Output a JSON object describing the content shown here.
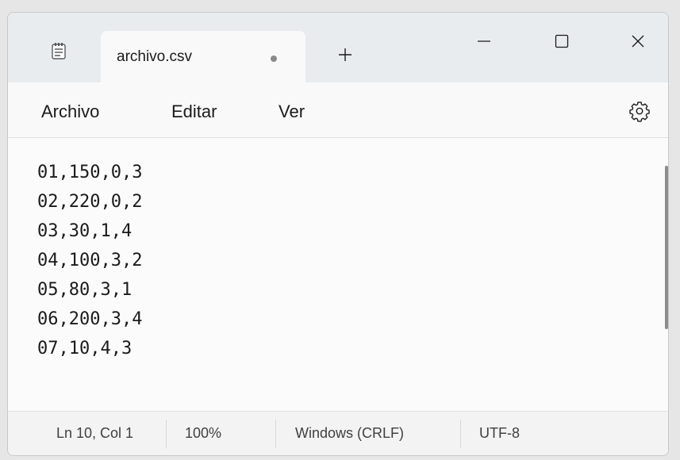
{
  "window": {
    "tab_title": "archivo.csv",
    "tab_state": "unsaved",
    "app_icon": "notepad-icon",
    "new_tab_icon": "plus-icon",
    "controls": [
      "minimize-icon",
      "maximize-icon",
      "close-icon"
    ]
  },
  "menu": {
    "items": [
      "Archivo",
      "Editar",
      "Ver"
    ],
    "settings_icon": "gear-icon"
  },
  "editor": {
    "lines": [
      "01,150,0,3",
      "02,220,0,2",
      "03,30,1,4",
      "04,100,3,2",
      "05,80,3,1",
      "06,200,3,4",
      "07,10,4,3"
    ]
  },
  "status": {
    "position": "Ln 10, Col 1",
    "zoom": "100%",
    "line_ending": "Windows (CRLF)",
    "encoding": "UTF-8"
  },
  "colors": {
    "titlebar": "#e9ecef",
    "editor_bg": "#fbfbfb",
    "text": "#1b1b1b"
  }
}
